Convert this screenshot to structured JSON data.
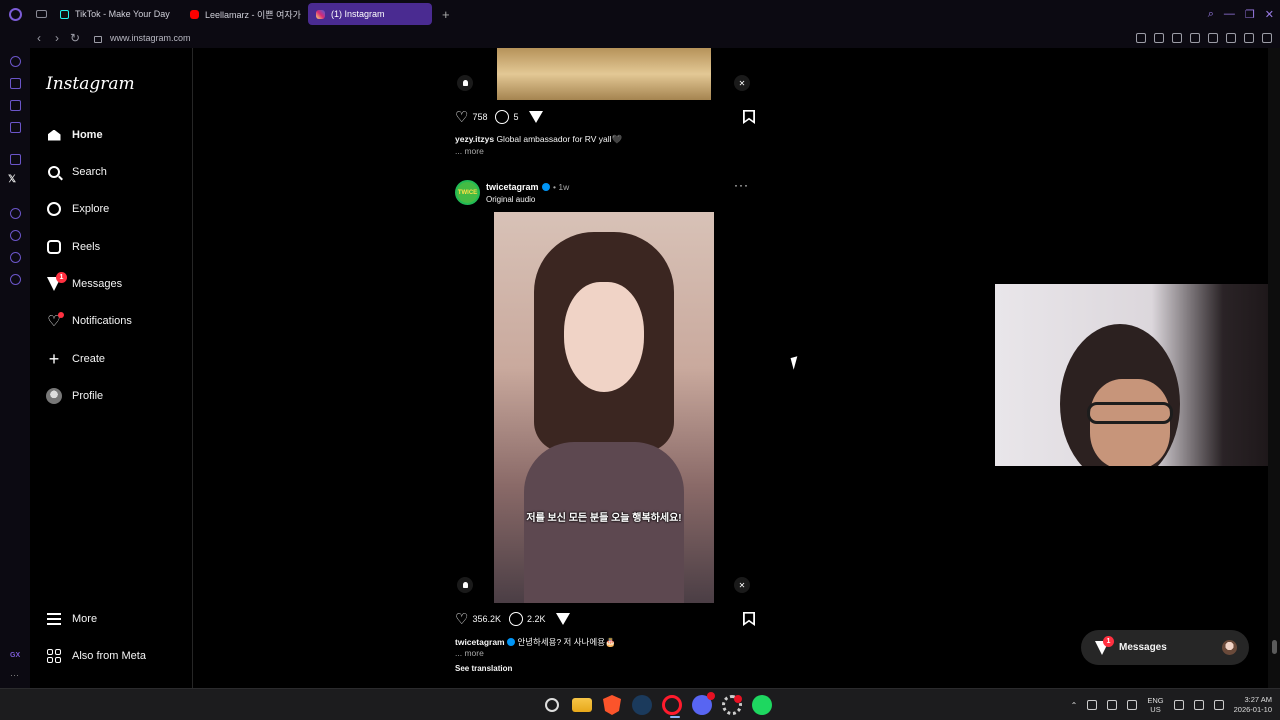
{
  "browser": {
    "tabs": [
      {
        "label": "TikTok - Make Your Day",
        "favicon": "tiktok-icon"
      },
      {
        "label": "Leellamarz - 이쁜 여자가",
        "favicon": "youtube-icon"
      },
      {
        "label": "(1) Instagram",
        "favicon": "instagram-icon",
        "active": true
      }
    ],
    "url": "www.instagram.com",
    "accent": "#4a2b91"
  },
  "opera_sidebar": {
    "gx_label": "GX",
    "dots_label": "···"
  },
  "instagram": {
    "logo": "Instagram",
    "nav": [
      {
        "label": "Home",
        "icon": "home-icon",
        "active": true
      },
      {
        "label": "Search",
        "icon": "search-icon"
      },
      {
        "label": "Explore",
        "icon": "compass-icon"
      },
      {
        "label": "Reels",
        "icon": "reels-icon"
      },
      {
        "label": "Messages",
        "icon": "messenger-icon",
        "badge": "1"
      },
      {
        "label": "Notifications",
        "icon": "heart-icon",
        "dot": true
      },
      {
        "label": "Create",
        "icon": "plus-icon"
      },
      {
        "label": "Profile",
        "icon": "avatar-icon"
      }
    ],
    "bottom_nav": [
      {
        "label": "More",
        "icon": "menu-icon"
      },
      {
        "label": "Also from Meta",
        "icon": "meta-icon"
      }
    ]
  },
  "feed": {
    "prev_post": {
      "likes": "758",
      "comments": "5",
      "username": "yezy.itzys",
      "caption": "Global ambassador for RV yall🖤",
      "more": "... more"
    },
    "post": {
      "username": "twicetagram",
      "avatar_text": "TWICE",
      "time": "1w",
      "separator": "•",
      "audio": "Original audio",
      "more_menu": "···",
      "subtitle": "저를 보신 모든 분들 오늘 행복하세요!",
      "likes": "356.2K",
      "comments": "2.2K",
      "caption": "안녕하세용? 저 사나에용🎂",
      "more": "... more",
      "see_translation": "See translation"
    }
  },
  "floating_messages": {
    "label": "Messages",
    "badge": "1"
  },
  "taskbar": {
    "apps": [
      "windows-start-icon",
      "search-icon",
      "file-explorer-icon",
      "brave-icon",
      "steam-icon",
      "opera-gx-icon",
      "discord-icon",
      "settings-icon",
      "spotify-icon"
    ],
    "discord_badge": "99+",
    "language": "ENG",
    "region": "US",
    "time": "3:27 AM",
    "date": "2026-01-10"
  }
}
